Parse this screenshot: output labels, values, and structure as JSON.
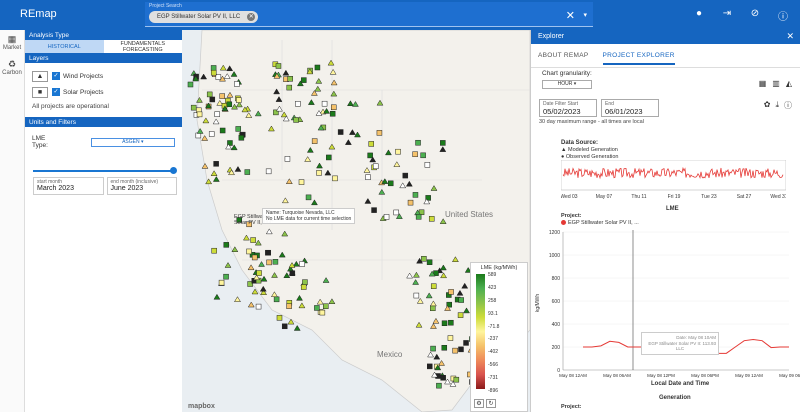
{
  "app": {
    "title": "REmap"
  },
  "search": {
    "label": "Project Search",
    "chip": "EGP Stillwater Solar PV II, LLC"
  },
  "topbar": {
    "icons": [
      "pin-icon",
      "export-icon",
      "layers-off-icon",
      "info-icon"
    ]
  },
  "rail": {
    "items": [
      {
        "label": "Market",
        "icon": "map-icon"
      },
      {
        "label": "Carbon",
        "icon": "co2-icon"
      }
    ]
  },
  "analysis": {
    "title": "Analysis Type",
    "tabs": [
      "HISTORICAL",
      "FUNDAMENTALS FORECASTING"
    ]
  },
  "layers": {
    "title": "Layers",
    "items": [
      {
        "label": "Wind Projects",
        "symbol": "▲"
      },
      {
        "label": "Solar Projects",
        "symbol": "■"
      }
    ],
    "note": "All projects are operational"
  },
  "units": {
    "title": "Units and Filters",
    "lme_label": "LME Type:",
    "lme_value": "ASGEN",
    "start_label": "start month",
    "start_value": "March 2023",
    "end_label": "end month (inclusive)",
    "end_value": "June 2023"
  },
  "map": {
    "tooltip_name": "Name: Turquoise Nevada, LLC",
    "tooltip_note": "No LME data for current time selection",
    "label_us": "United States",
    "label_mx": "Mexico",
    "logo": "mapbox",
    "partial_label_1": "EGP Stillwater",
    "partial_label_2": "Solar PV II, LLC",
    "legend_title": "LME (kg/MWh)",
    "legend_ticks": [
      "589",
      "423",
      "258",
      "93.1",
      "-71.8",
      "-237",
      "-402",
      "-566",
      "-731",
      "-896"
    ]
  },
  "explorer": {
    "title": "Explorer",
    "tabs": [
      "ABOUT REMAP",
      "PROJECT EXPLORER"
    ],
    "granularity_label": "Chart granularity:",
    "granularity_value": "HOUR",
    "date_start_label": "Date Filter Start",
    "date_start": "05/02/2023",
    "date_end_label": "End",
    "date_end": "06/01/2023",
    "range_note": "30 day maximum range - all times are local",
    "data_source_title": "Data Source:",
    "data_source_items": [
      "Modeled Generation",
      "Observed Generation"
    ],
    "lme_title": "LME",
    "project_label": "Project:",
    "project_name": "EGP Stillwater Solar PV II, ...",
    "generation_title": "Generation",
    "project_label_2": "Project:",
    "hover_date": "Date: May 08 10AM",
    "hover_value": "EGP Stillwater Solar PV II: 113.93",
    "hover_unit": "LLC"
  },
  "chart_data": [
    {
      "type": "line",
      "title": "",
      "xlabel": "",
      "ylabel": "",
      "x": [
        "Wed 03",
        "May 07",
        "Thu 11",
        "Fri 19",
        "Tue 23",
        "Sat 27",
        "Wed 31"
      ],
      "series": [
        {
          "name": "EGP Stillwater Solar PV II, ...",
          "color": "#e53935"
        }
      ]
    },
    {
      "type": "line",
      "title": "LME",
      "xlabel": "Local Date and Time",
      "ylabel": "kg/MWh",
      "ylim": [
        0,
        1200
      ],
      "yticks": [
        "1200",
        "1000",
        "800",
        "600",
        "400",
        "200",
        "0"
      ],
      "categories": [
        "May 08 12AM",
        "May 08 06AM",
        "May 08 12PM",
        "May 08 06PM",
        "May 09 12AM",
        "May 09 06AM"
      ],
      "x_hours": [
        0,
        3,
        6,
        9,
        12,
        15,
        18,
        21,
        24,
        27,
        30,
        33,
        36,
        39,
        42,
        45,
        48,
        51,
        54,
        57
      ],
      "series": [
        {
          "name": "EGP Stillwater Solar PV II, ...",
          "values": [
            200,
            200,
            210,
            250,
            240,
            200,
            200,
            200,
            205,
            230,
            290,
            300,
            240,
            195,
            165,
            145,
            145,
            200,
            255,
            265,
            255,
            195,
            200,
            200
          ]
        }
      ]
    }
  ]
}
